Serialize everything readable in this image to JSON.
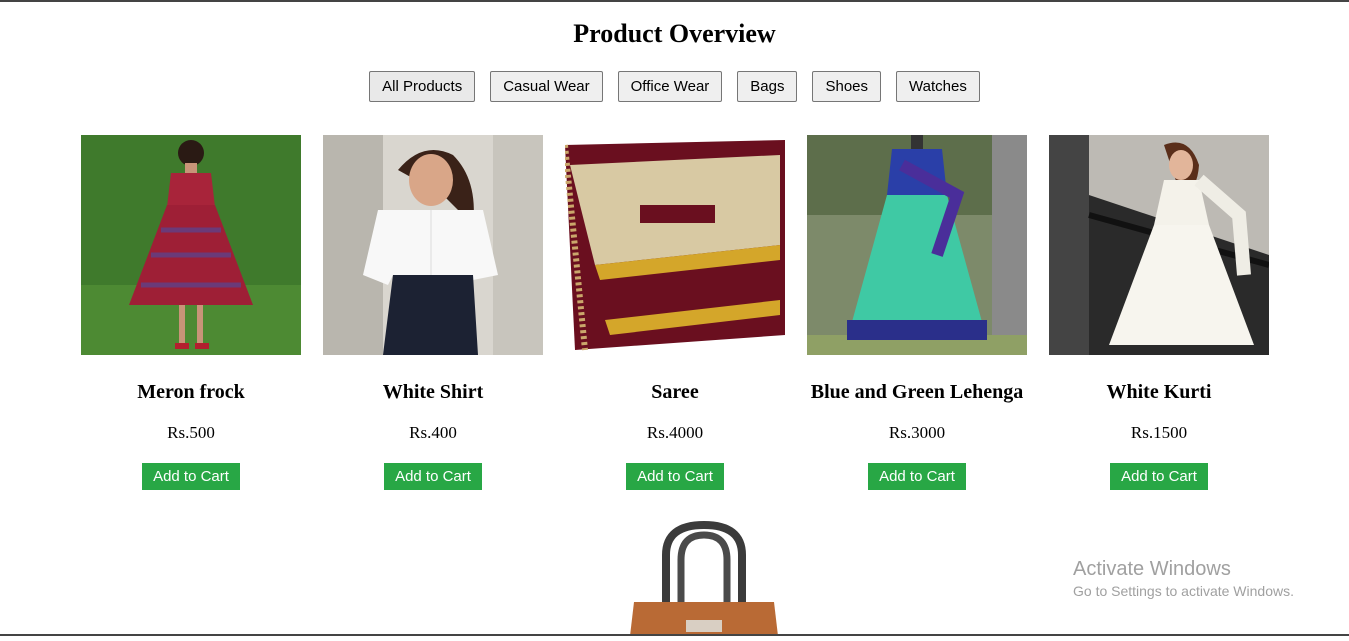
{
  "page": {
    "title": "Product Overview"
  },
  "filters": [
    {
      "label": "All Products"
    },
    {
      "label": "Casual Wear"
    },
    {
      "label": "Office Wear"
    },
    {
      "label": "Bags"
    },
    {
      "label": "Shoes"
    },
    {
      "label": "Watches"
    }
  ],
  "products": [
    {
      "name": "Meron frock",
      "price": "Rs.500",
      "cart_label": "Add to Cart"
    },
    {
      "name": "White Shirt",
      "price": "Rs.400",
      "cart_label": "Add to Cart"
    },
    {
      "name": "Saree",
      "price": "Rs.4000",
      "cart_label": "Add to Cart"
    },
    {
      "name": "Blue and Green Lehenga",
      "price": "Rs.3000",
      "cart_label": "Add to Cart"
    },
    {
      "name": "White Kurti",
      "price": "Rs.1500",
      "cart_label": "Add to Cart"
    }
  ],
  "watermark": {
    "title": "Activate Windows",
    "subtitle": "Go to Settings to activate Windows."
  },
  "colors": {
    "cart_button": "#28a745",
    "cart_text": "#ffffff",
    "filter_bg": "#efefef"
  }
}
